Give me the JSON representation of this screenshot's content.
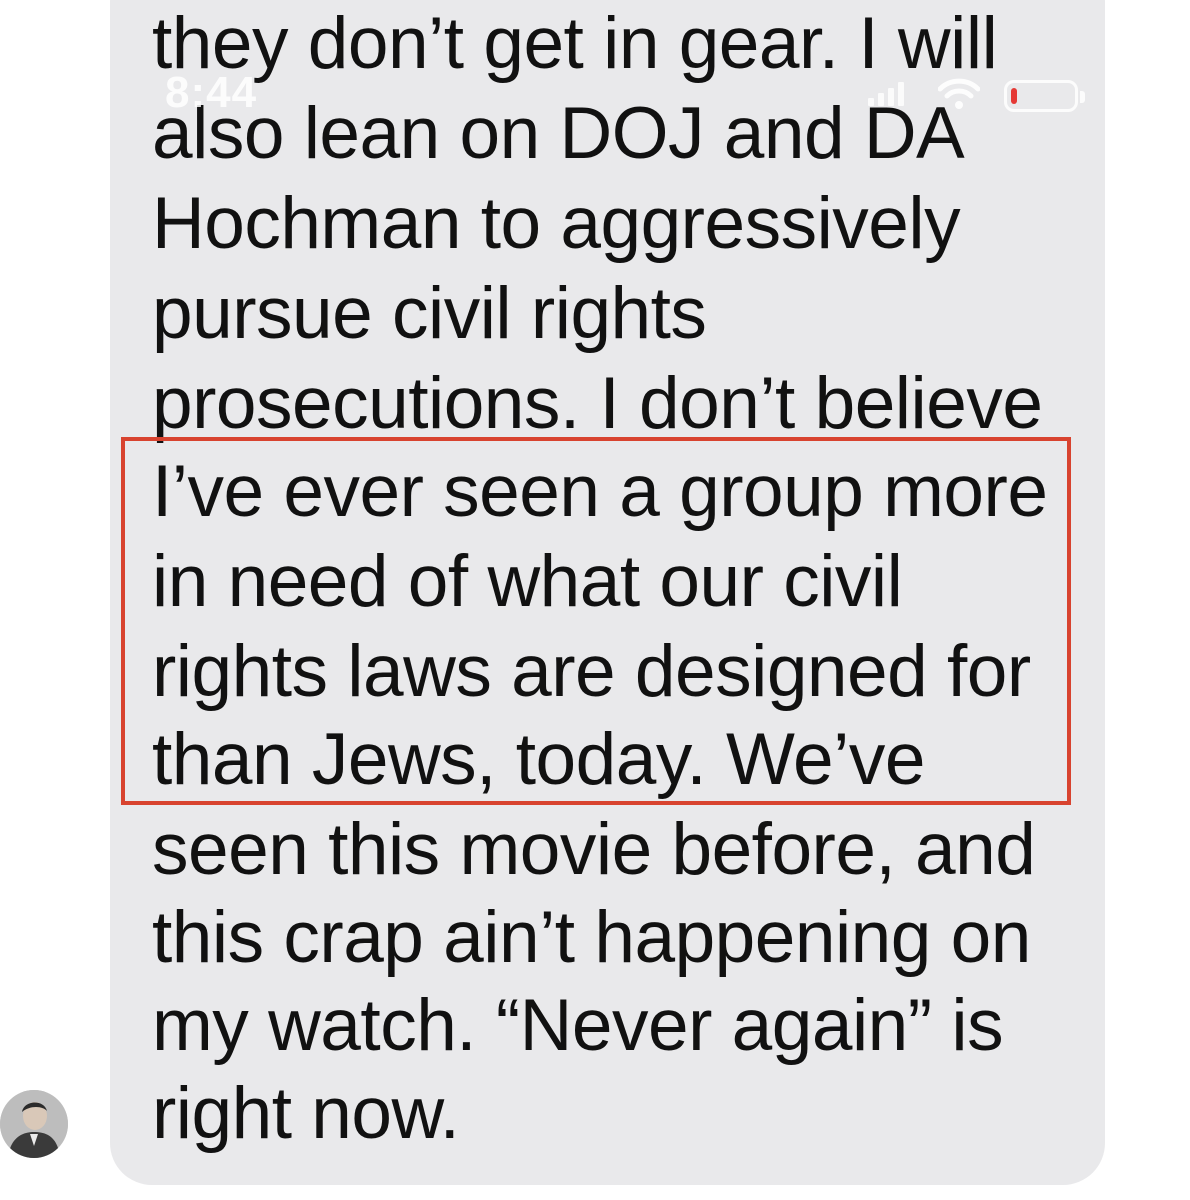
{
  "status_bar": {
    "time": "8:44",
    "battery_level_fraction": 0.1,
    "battery_color": "#e53935"
  },
  "message": {
    "lines": [
      "they don’t get in gear. I will",
      "also lean on DOJ and DA",
      "Hochman to aggressively",
      "pursue civil rights",
      "prosecutions. I don’t believe",
      "I’ve ever seen a group more",
      "in need of what our civil",
      "rights laws are designed for",
      "than Jews, today. We’ve",
      "seen this movie before, and",
      "this crap ain’t happening on",
      "my watch. “Never again” is",
      "right now."
    ],
    "bubble_color": "#e9e9eb",
    "highlight_color": "#d8432f"
  },
  "sender": {
    "avatar_icon": "person-avatar-icon"
  }
}
